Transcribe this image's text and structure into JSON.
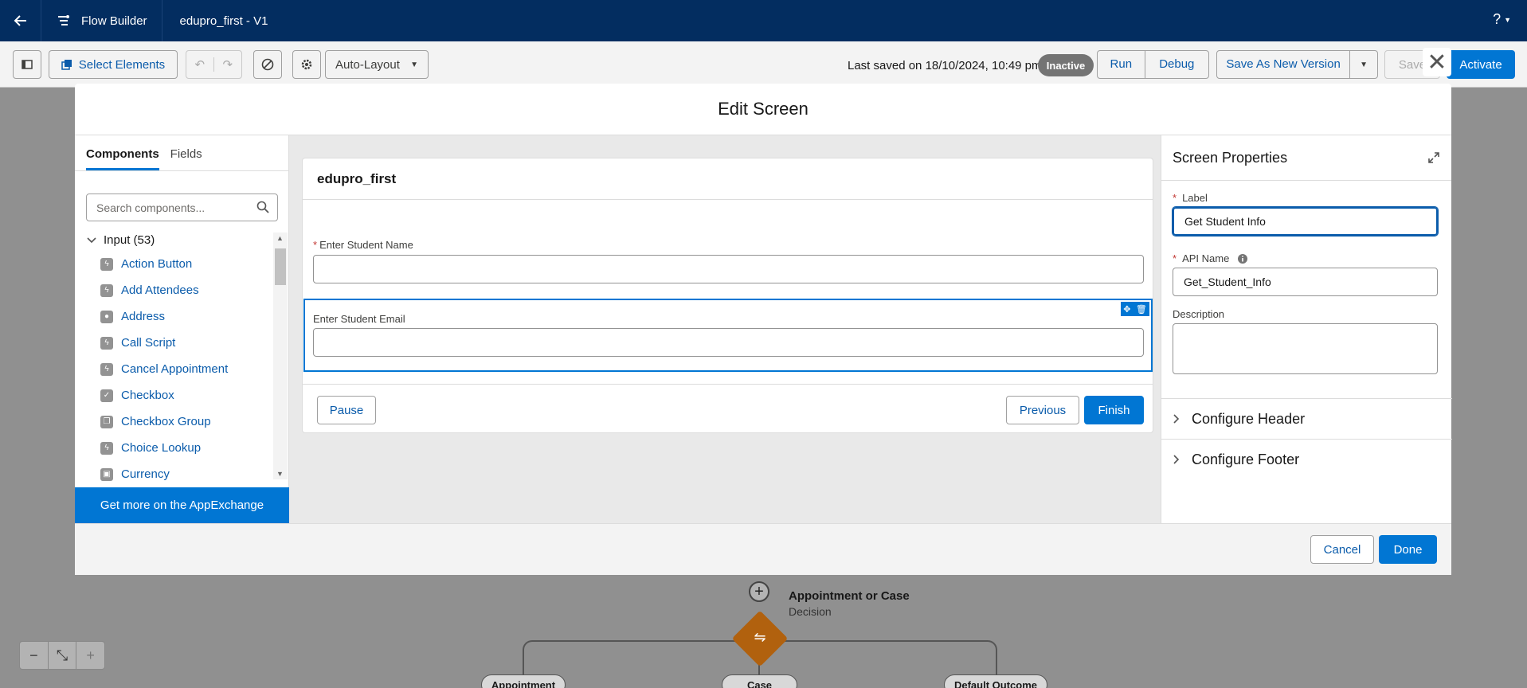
{
  "header": {
    "app_title": "Flow Builder",
    "flow_name": "edupro_first - V1",
    "help": "?"
  },
  "toolbar": {
    "select_elements": "Select Elements",
    "layout": "Auto-Layout",
    "last_saved": "Last saved on 18/10/2024, 10:49 pm",
    "status": "Inactive",
    "run": "Run",
    "debug": "Debug",
    "save_as_new_version": "Save As New Version",
    "save": "Save",
    "activate": "Activate"
  },
  "modal": {
    "title": "Edit Screen",
    "cancel": "Cancel",
    "done": "Done"
  },
  "left_panel": {
    "tabs": [
      "Components",
      "Fields"
    ],
    "search_placeholder": "Search components...",
    "group": "Input (53)",
    "components": [
      "Action Button",
      "Add Attendees",
      "Address",
      "Call Script",
      "Cancel Appointment",
      "Checkbox",
      "Checkbox Group",
      "Choice Lookup",
      "Currency"
    ],
    "appexchange": "Get more on the AppExchange"
  },
  "screen_canvas": {
    "title": "edupro_first",
    "field1_label": "Enter Student Name",
    "field2_label": "Enter Student Email",
    "pause": "Pause",
    "previous": "Previous",
    "finish": "Finish"
  },
  "right_panel": {
    "title": "Screen Properties",
    "label_label": "Label",
    "label_value": "Get Student Info",
    "api_label": "API Name",
    "api_value": "Get_Student_Info",
    "description_label": "Description",
    "section_header": "Configure Header",
    "section_footer": "Configure Footer"
  },
  "flow_canvas": {
    "decision_title": "Appointment or Case",
    "decision_type": "Decision",
    "branches": [
      "Appointment",
      "Case",
      "Default Outcome"
    ]
  },
  "zoom": [
    "−",
    "⤡",
    "+"
  ]
}
